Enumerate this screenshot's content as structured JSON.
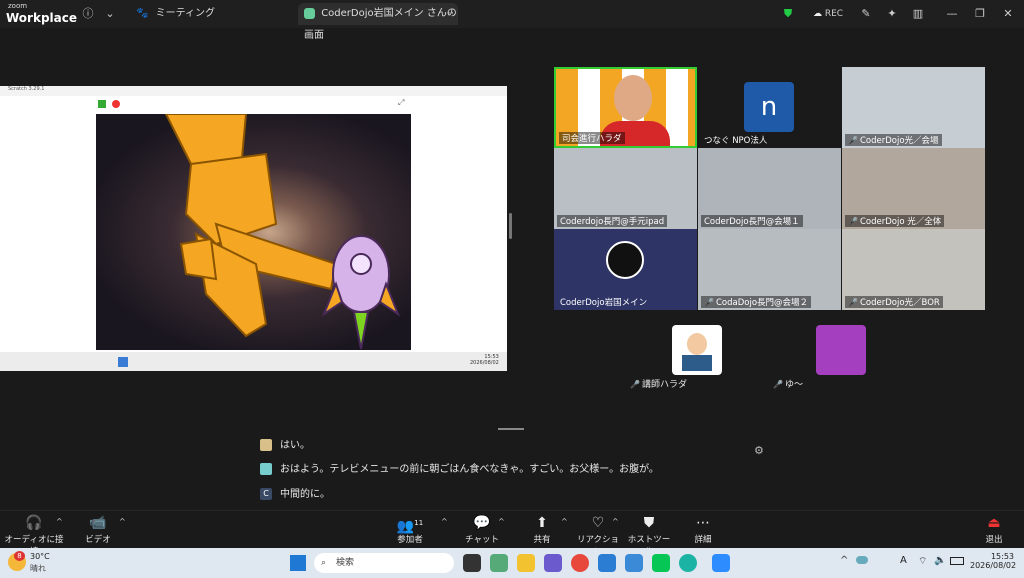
{
  "app": {
    "logo_top": "zoom",
    "logo_bottom": "Workplace",
    "meeting_tab": "ミーティング",
    "share_tab": "CoderDojo岩国メイン さんの画面",
    "rec_label": "REC"
  },
  "share": {
    "scratch_title": "Scratch 3.29.1",
    "taskbar_time": "15:53",
    "taskbar_date": "2026/08/02"
  },
  "tiles": [
    {
      "name": "司会進行ハラダ"
    },
    {
      "name": "つなぐ NPO法人",
      "avatar_letter": "n"
    },
    {
      "name": "CoderDojo光／会場"
    },
    {
      "name": "Coderdojo長門@手元ipad"
    },
    {
      "name": "CoderDojo長門@会場１"
    },
    {
      "name": "CoderDojo 光／全体"
    },
    {
      "name": "CoderDojo岩国メイン"
    },
    {
      "name": "CodaDojo長門@会場２"
    },
    {
      "name": "CoderDojo光／BOR"
    },
    {
      "name": "講師ハラダ"
    },
    {
      "name": "ゆ〜"
    }
  ],
  "chat": [
    {
      "text": "はい。"
    },
    {
      "text": "おはよう。テレビメニューの前に朝ごはん食べなきゃ。すごい。お父様ー。お腹が。"
    },
    {
      "text": "中間的に。",
      "avatar_letter": "C"
    }
  ],
  "toolbar": {
    "audio": "オーディオに接続",
    "video": "ビデオ",
    "participants": "参加者",
    "participants_count": "11",
    "chat": "チャット",
    "share": "共有",
    "reactions": "リアクション",
    "host_tools": "ホストツール",
    "more": "詳細",
    "leave": "退出"
  },
  "windows": {
    "weather_temp": "30°C",
    "weather_desc": "晴れ",
    "weather_badge": "8",
    "search_placeholder": "検索",
    "time": "15:53",
    "date": "2026/08/02",
    "ime": "A"
  }
}
